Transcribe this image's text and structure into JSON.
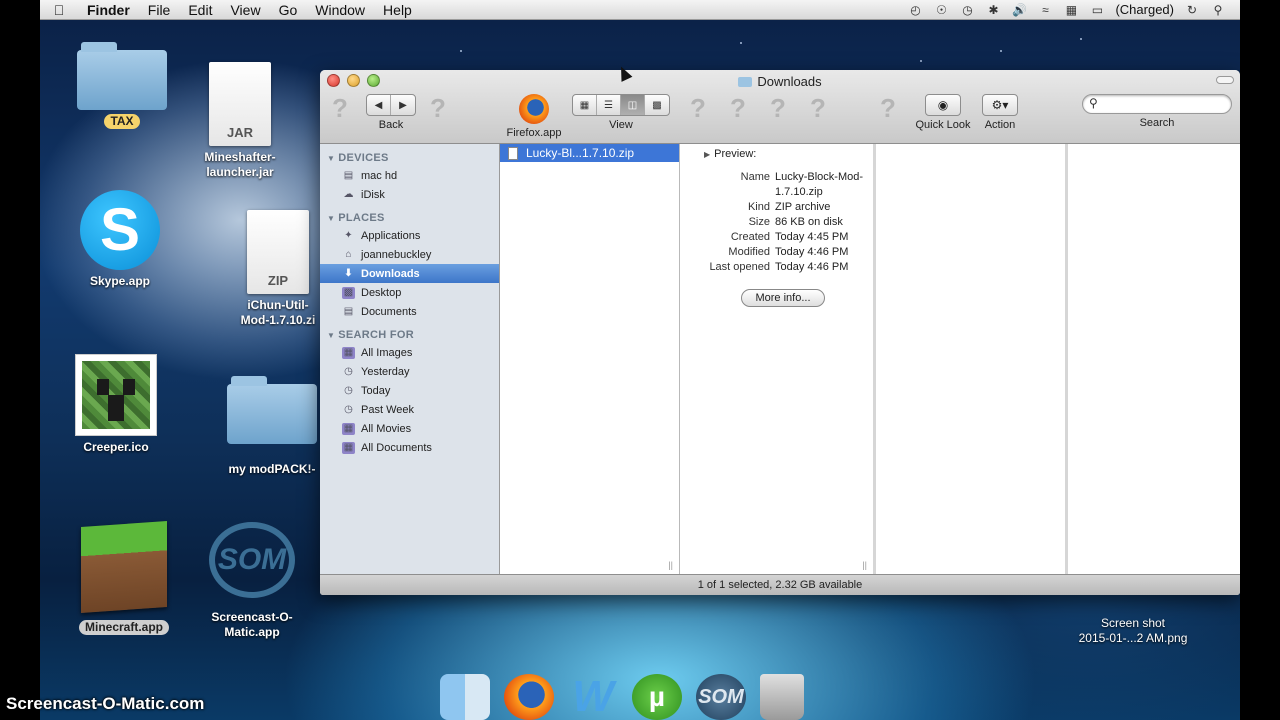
{
  "menubar": {
    "apple_icon": "apple-logo",
    "items": [
      "Finder",
      "File",
      "Edit",
      "View",
      "Go",
      "Window",
      "Help"
    ],
    "battery_status": "(Charged)",
    "status_icons": [
      "time-machine-icon",
      "accessibility-icon",
      "clock-icon",
      "bluetooth-icon",
      "volume-icon",
      "wifi-icon",
      "keyboard-icon",
      "battery-icon",
      "sync-icon",
      "spotlight-icon"
    ]
  },
  "desktop": {
    "icons": [
      {
        "name": "TAX",
        "kind": "folder"
      },
      {
        "name": "Mineshafter-\nlauncher.jar",
        "kind": "jar",
        "badge": "JAR"
      },
      {
        "name": "Skype.app",
        "kind": "app",
        "glyph": "S"
      },
      {
        "name": "iChun-Util-\nMod-1.7.10.zi",
        "kind": "zip",
        "badge": "ZIP"
      },
      {
        "name": "Creeper.ico",
        "kind": "image"
      },
      {
        "name": "my modPACK!-",
        "kind": "folder"
      },
      {
        "name": "Minecraft.app",
        "kind": "app"
      },
      {
        "name": "Screencast-O-\nMatic.app",
        "kind": "app",
        "glyph": "SOM"
      },
      {
        "name": "Screen shot\n2015-01-...2 AM.png",
        "kind": "image"
      }
    ]
  },
  "finder": {
    "title": "Downloads",
    "toolbar": {
      "back_label": "Back",
      "firefox_label": "Firefox.app",
      "view_label": "View",
      "quicklook_label": "Quick Look",
      "action_label": "Action",
      "search_label": "Search",
      "search_placeholder": ""
    },
    "sidebar": {
      "devices_header": "DEVICES",
      "devices": [
        "mac hd",
        "iDisk"
      ],
      "places_header": "PLACES",
      "places": [
        "Applications",
        "joannebuckley",
        "Downloads",
        "Desktop",
        "Documents"
      ],
      "search_header": "SEARCH FOR",
      "searches": [
        "All Images",
        "Yesterday",
        "Today",
        "Past Week",
        "All Movies",
        "All Documents"
      ]
    },
    "files": [
      "Lucky-Bl...1.7.10.zip"
    ],
    "preview": {
      "header": "Preview:",
      "rows": [
        {
          "k": "Name",
          "v": "Lucky-Block-Mod-1.7.10.zip"
        },
        {
          "k": "Kind",
          "v": "ZIP archive"
        },
        {
          "k": "Size",
          "v": "86 KB on disk"
        },
        {
          "k": "Created",
          "v": "Today 4:45 PM"
        },
        {
          "k": "Modified",
          "v": "Today 4:46 PM"
        },
        {
          "k": "Last opened",
          "v": "Today 4:46 PM"
        }
      ],
      "more_info": "More info..."
    },
    "status": "1 of 1 selected, 2.32 GB available"
  },
  "dock": [
    "Finder",
    "Firefox",
    "Word",
    "uTorrent",
    "Screencast-O-Matic",
    "Trash"
  ],
  "watermark": "Screencast-O-Matic.com",
  "colors": {
    "selection": "#3d76c9",
    "sidebar_bg": "#dde3ea"
  }
}
